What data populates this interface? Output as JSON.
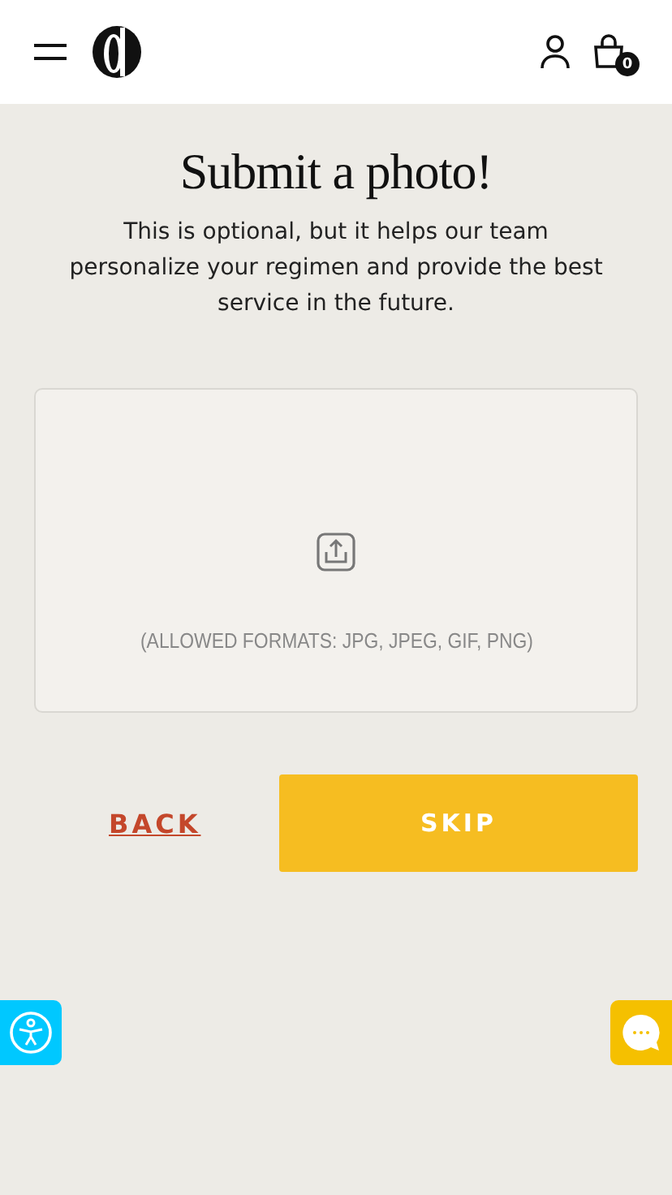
{
  "header": {
    "cart_count": "0"
  },
  "title": "Submit a photo!",
  "description": "This is optional, but it helps our team personalize your regimen and provide the best service in the future.",
  "upload": {
    "hint": "(ALLOWED FORMATS: JPG, JPEG, GIF, PNG)"
  },
  "buttons": [
    {
      "kind": "link",
      "label": "BACK"
    },
    {
      "kind": "primary",
      "label": "SKIP"
    }
  ]
}
